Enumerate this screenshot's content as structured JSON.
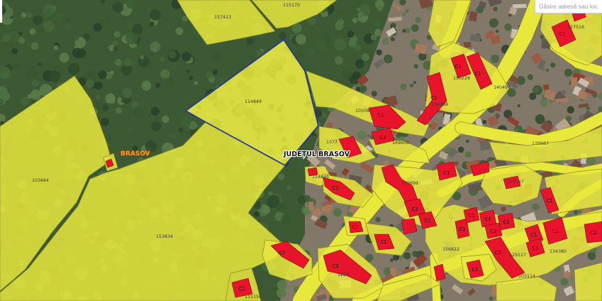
{
  "search": {
    "placeholder": "Găsire adresă sau loc"
  },
  "place_labels": {
    "locality": "BRASOV",
    "county": "JUDEȚUL BRAȘOV"
  },
  "parcels": [
    {
      "number": "157413"
    },
    {
      "number": "115170"
    },
    {
      "number": "114849",
      "selected": true
    },
    {
      "number": "103664"
    },
    {
      "number": "153834"
    },
    {
      "number": "115158"
    },
    {
      "number": "10509"
    },
    {
      "number": "1377"
    },
    {
      "number": "114846"
    },
    {
      "number": "169609"
    },
    {
      "number": "129699"
    },
    {
      "number": "150228"
    },
    {
      "number": "104598"
    },
    {
      "number": "140497"
    },
    {
      "number": "127516"
    },
    {
      "number": "139987"
    },
    {
      "number": "129147"
    },
    {
      "number": "156822"
    },
    {
      "number": "129117"
    },
    {
      "number": "134380"
    },
    {
      "number": "103114"
    },
    {
      "number": "1257"
    }
  ],
  "buildings": [
    "C1",
    "C2",
    "C1",
    "C1",
    "C1",
    "C2",
    "C1",
    "C1",
    "C2",
    "C1",
    "C1",
    "C1",
    "C1",
    "C2",
    "C1",
    "C1",
    "C1",
    "C1",
    "C1",
    "C2",
    "C2",
    "C1",
    "C1",
    "C3",
    "C1",
    "C1",
    "C1"
  ],
  "colors": {
    "parcel_fill": "#e8e83c",
    "building_fill": "#e8142b",
    "selected_outline": "#27379b",
    "locality_label": "#ff9a1f"
  }
}
